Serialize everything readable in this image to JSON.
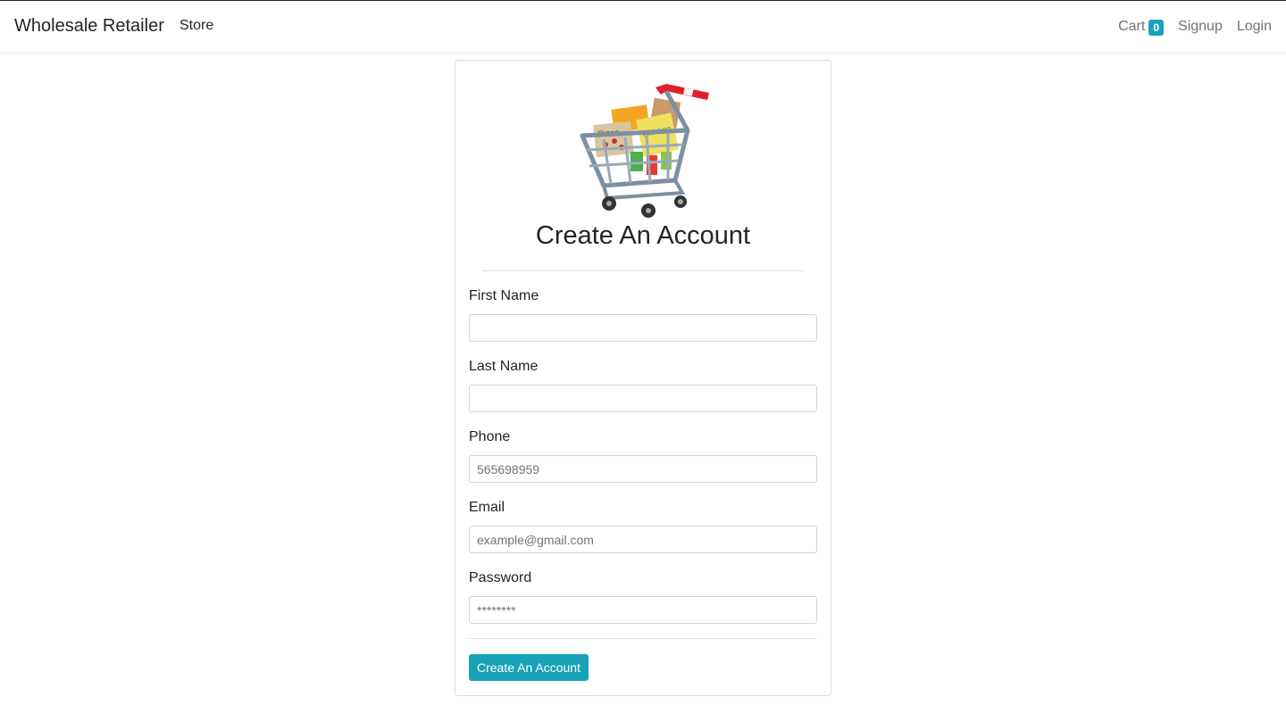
{
  "navbar": {
    "brand": "Wholesale Retailer",
    "store_label": "Store",
    "cart_label": "Cart",
    "cart_count": "0",
    "signup_label": "Signup",
    "login_label": "Login"
  },
  "card": {
    "image_icon": "shopping-cart-with-groceries-icon",
    "title": "Create An Account",
    "fields": [
      {
        "label": "First Name",
        "value": "",
        "placeholder": ""
      },
      {
        "label": "Last Name",
        "value": "",
        "placeholder": ""
      },
      {
        "label": "Phone",
        "value": "",
        "placeholder": "565698959"
      },
      {
        "label": "Email",
        "value": "",
        "placeholder": "example@gmail.com"
      },
      {
        "label": "Password",
        "value": "",
        "placeholder": "********"
      }
    ],
    "submit_label": "Create An Account"
  },
  "colors": {
    "accent": "#17a2b8",
    "text": "#212529",
    "muted": "#6c757d"
  }
}
